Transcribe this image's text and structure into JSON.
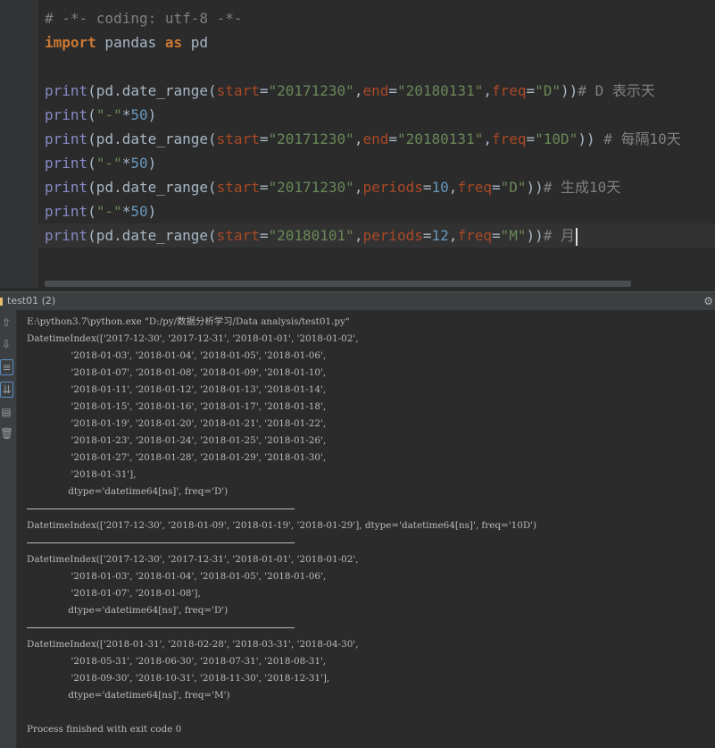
{
  "editor": {
    "line1": {
      "comment": "# -*- coding: utf-8 -*-"
    },
    "line2": {
      "kw1": "import",
      "mid": " pandas ",
      "kw2": "as",
      "tail": " pd"
    },
    "line4": {
      "fn": "print",
      "a": "(pd.date_range(",
      "p1": "start",
      "eq1": "=",
      "s1": "\"20171230\"",
      "c1": ",",
      "p2": "end",
      "eq2": "=",
      "s2": "\"20180131\"",
      "c2": ",",
      "p3": "freq",
      "eq3": "=",
      "s3": "\"D\"",
      "close": "))",
      "comment": "# D 表示天"
    },
    "line5": {
      "fn": "print",
      "a": "(",
      "s": "\"-\"",
      "op": "*",
      "num": "50",
      "close": ")"
    },
    "line6": {
      "fn": "print",
      "a": "(pd.date_range(",
      "p1": "start",
      "eq1": "=",
      "s1": "\"20171230\"",
      "c1": ",",
      "p2": "end",
      "eq2": "=",
      "s2": "\"20180131\"",
      "c2": ",",
      "p3": "freq",
      "eq3": "=",
      "s3": "\"10D\"",
      "close": ")) ",
      "comment": "# 每隔10天"
    },
    "line7": {
      "fn": "print",
      "a": "(",
      "s": "\"-\"",
      "op": "*",
      "num": "50",
      "close": ")"
    },
    "line8": {
      "fn": "print",
      "a": "(pd.date_range(",
      "p1": "start",
      "eq1": "=",
      "s1": "\"20171230\"",
      "c1": ",",
      "p2": "periods",
      "eq2": "=",
      "n2": "10",
      "c2": ",",
      "p3": "freq",
      "eq3": "=",
      "s3": "\"D\"",
      "close": "))",
      "comment": "# 生成10天"
    },
    "line9": {
      "fn": "print",
      "a": "(",
      "s": "\"-\"",
      "op": "*",
      "num": "50",
      "close": ")"
    },
    "line10": {
      "fn": "print",
      "a": "(pd.date_range(",
      "p1": "start",
      "eq1": "=",
      "s1": "\"20180101\"",
      "c1": ",",
      "p2": "periods",
      "eq2": "=",
      "n2": "12",
      "c2": ",",
      "p3": "freq",
      "eq3": "=",
      "s3": "\"M\"",
      "close": "))",
      "comment": "# 月"
    }
  },
  "run_panel": {
    "tab_label": "test01 (2)",
    "settings_icon": "⚙"
  },
  "toolbar": {
    "up": "⇧",
    "down": "⇩",
    "wrap": "≡",
    "scroll": "⇊",
    "print": "▤",
    "trash": "🗑"
  },
  "console": {
    "lines": [
      "E:\\python3.7\\python.exe \"D:/py/数据分析学习/Data analysis/test01.py\"",
      "DatetimeIndex(['2017-12-30', '2017-12-31', '2018-01-01', '2018-01-02',",
      "               '2018-01-03', '2018-01-04', '2018-01-05', '2018-01-06',",
      "               '2018-01-07', '2018-01-08', '2018-01-09', '2018-01-10',",
      "               '2018-01-11', '2018-01-12', '2018-01-13', '2018-01-14',",
      "               '2018-01-15', '2018-01-16', '2018-01-17', '2018-01-18',",
      "               '2018-01-19', '2018-01-20', '2018-01-21', '2018-01-22',",
      "               '2018-01-23', '2018-01-24', '2018-01-25', '2018-01-26',",
      "               '2018-01-27', '2018-01-28', '2018-01-29', '2018-01-30',",
      "               '2018-01-31'],",
      "              dtype='datetime64[ns]', freq='D')",
      "--------------------------------------------------",
      "DatetimeIndex(['2017-12-30', '2018-01-09', '2018-01-19', '2018-01-29'], dtype='datetime64[ns]', freq='10D')",
      "--------------------------------------------------",
      "DatetimeIndex(['2017-12-30', '2017-12-31', '2018-01-01', '2018-01-02',",
      "               '2018-01-03', '2018-01-04', '2018-01-05', '2018-01-06',",
      "               '2018-01-07', '2018-01-08'],",
      "              dtype='datetime64[ns]', freq='D')",
      "--------------------------------------------------",
      "DatetimeIndex(['2018-01-31', '2018-02-28', '2018-03-31', '2018-04-30',",
      "               '2018-05-31', '2018-06-30', '2018-07-31', '2018-08-31',",
      "               '2018-09-30', '2018-10-31', '2018-11-30', '2018-12-31'],",
      "              dtype='datetime64[ns]', freq='M')",
      "",
      "Process finished with exit code 0"
    ]
  }
}
